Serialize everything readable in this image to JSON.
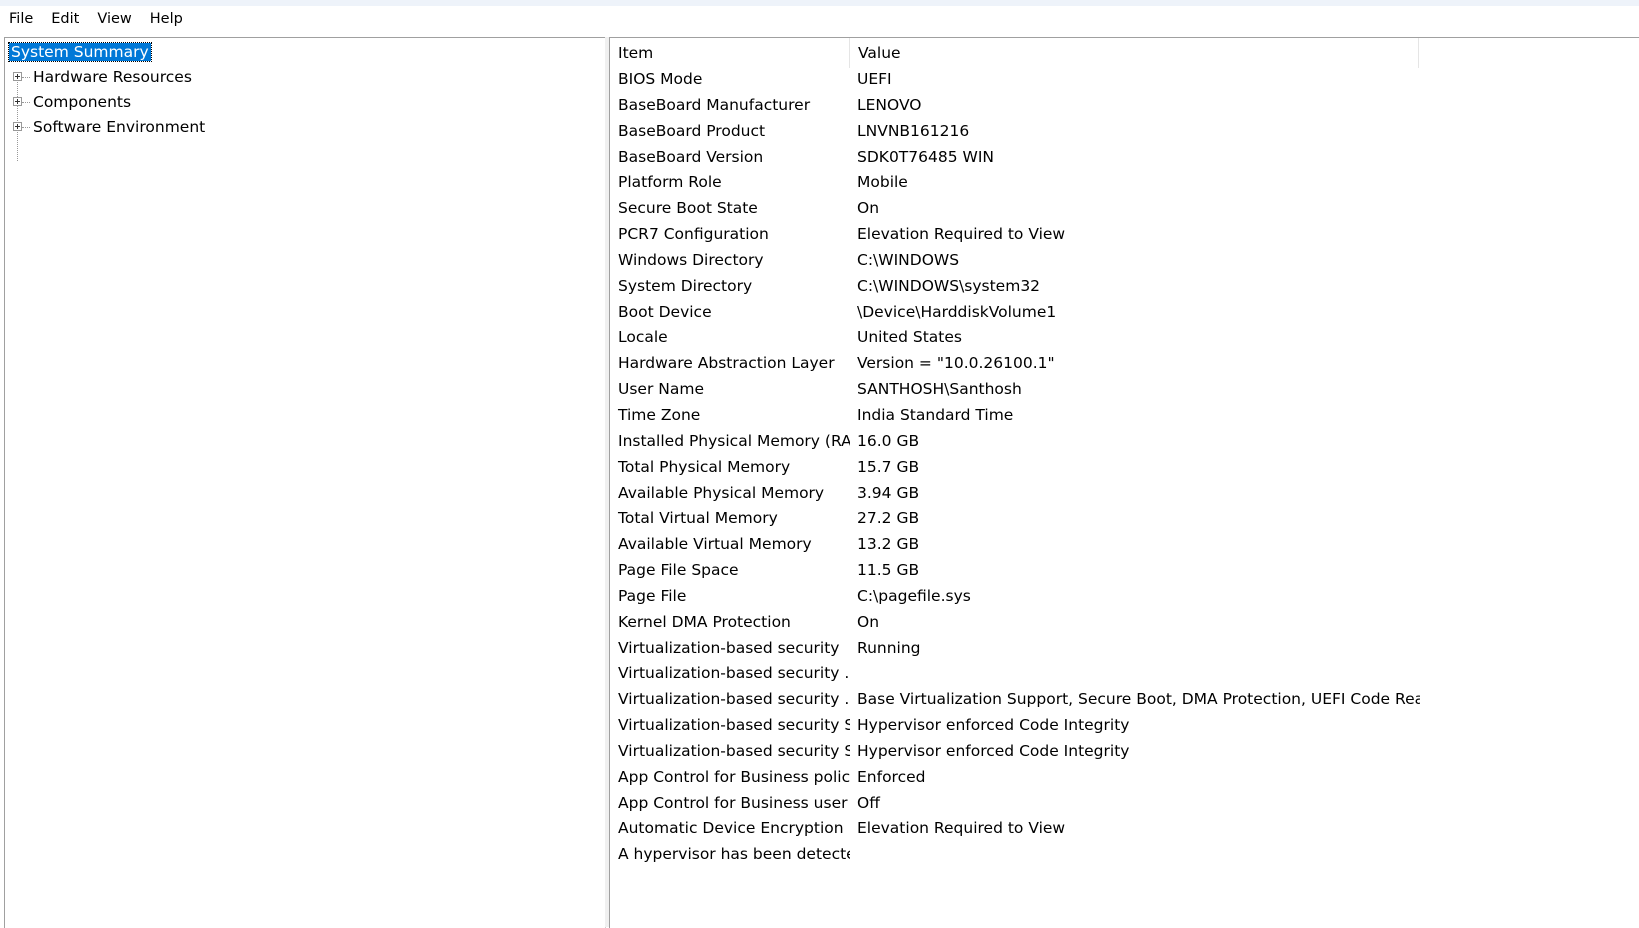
{
  "menu": [
    "File",
    "Edit",
    "View",
    "Help"
  ],
  "tree": {
    "root": "System Summary",
    "children": [
      "Hardware Resources",
      "Components",
      "Software Environment"
    ]
  },
  "table": {
    "headers": [
      "Item",
      "Value"
    ],
    "rows": [
      [
        "BIOS Mode",
        "UEFI"
      ],
      [
        "BaseBoard Manufacturer",
        "LENOVO"
      ],
      [
        "BaseBoard Product",
        "LNVNB161216"
      ],
      [
        "BaseBoard Version",
        "SDK0T76485 WIN"
      ],
      [
        "Platform Role",
        "Mobile"
      ],
      [
        "Secure Boot State",
        "On"
      ],
      [
        "PCR7 Configuration",
        "Elevation Required to View"
      ],
      [
        "Windows Directory",
        "C:\\WINDOWS"
      ],
      [
        "System Directory",
        "C:\\WINDOWS\\system32"
      ],
      [
        "Boot Device",
        "\\Device\\HarddiskVolume1"
      ],
      [
        "Locale",
        "United States"
      ],
      [
        "Hardware Abstraction Layer",
        "Version = \"10.0.26100.1\""
      ],
      [
        "User Name",
        "SANTHOSH\\Santhosh"
      ],
      [
        "Time Zone",
        "India Standard Time"
      ],
      [
        "Installed Physical Memory (RA...",
        "16.0 GB"
      ],
      [
        "Total Physical Memory",
        "15.7 GB"
      ],
      [
        "Available Physical Memory",
        "3.94 GB"
      ],
      [
        "Total Virtual Memory",
        "27.2 GB"
      ],
      [
        "Available Virtual Memory",
        "13.2 GB"
      ],
      [
        "Page File Space",
        "11.5 GB"
      ],
      [
        "Page File",
        "C:\\pagefile.sys"
      ],
      [
        "Kernel DMA Protection",
        "On"
      ],
      [
        "Virtualization-based security",
        "Running"
      ],
      [
        "Virtualization-based security ...",
        ""
      ],
      [
        "Virtualization-based security ...",
        "Base Virtualization Support, Secure Boot, DMA Protection, UEFI Code Read..."
      ],
      [
        "Virtualization-based security S...",
        "Hypervisor enforced Code Integrity"
      ],
      [
        "Virtualization-based security S...",
        "Hypervisor enforced Code Integrity"
      ],
      [
        "App Control for Business policy",
        "Enforced"
      ],
      [
        "App Control for Business user ...",
        "Off"
      ],
      [
        "Automatic Device Encryption ...",
        "Elevation Required to View"
      ],
      [
        "A hypervisor has been detecte...",
        ""
      ]
    ]
  }
}
